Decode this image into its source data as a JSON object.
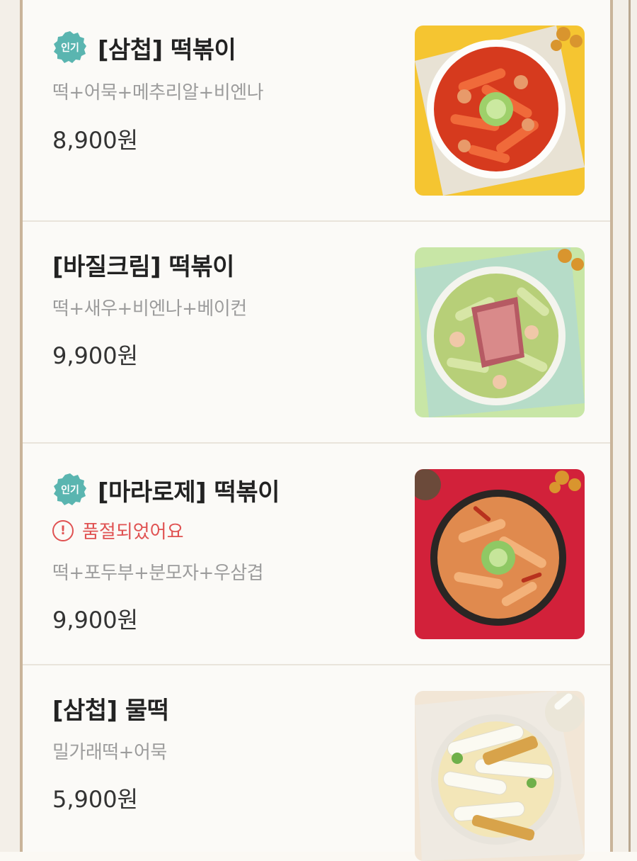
{
  "menu": {
    "items": [
      {
        "name": "[삼첩] 떡볶이",
        "badge": "인기",
        "description": "떡+어묵+메추리알+비엔나",
        "price": "8,900원",
        "image": "red-tteokbokki-bowl"
      },
      {
        "name": "[바질크림] 떡볶이",
        "description": "떡+새우+비엔나+베이컨",
        "price": "9,900원",
        "image": "basil-cream-tteokbokki-bowl"
      },
      {
        "name": "[마라로제] 떡볶이",
        "badge": "인기",
        "status": "품절되었어요",
        "status_icon": "!",
        "description": "떡+포두부+분모자+우삼겹",
        "price": "9,900원",
        "image": "mala-rose-tteokbokki-bowl"
      },
      {
        "name": "[삼첩] 물떡",
        "description": "밀가래떡+어묵",
        "price": "5,900원",
        "image": "mulddeok-broth-bowl"
      }
    ]
  },
  "colors": {
    "badge": "#5ab5b0",
    "soldout": "#e05252",
    "frame": "#c9b49a"
  }
}
